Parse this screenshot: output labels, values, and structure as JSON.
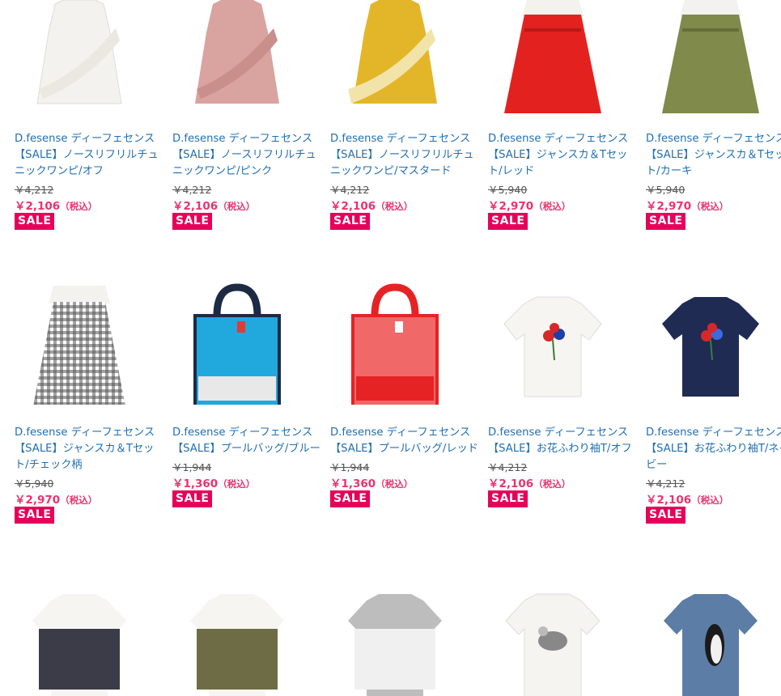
{
  "products_row1": [
    {
      "title": "D.fesense ディーフェセンス【SALE】ノースリフリルチュニックワンピ/オフ",
      "old_price": "￥4,212",
      "price": "￥2,106",
      "tax": "（税込）",
      "badge": "SALE",
      "image": "white-ruffle-tunic",
      "color": "#f4f2ee"
    },
    {
      "title": "D.fesense ディーフェセンス【SALE】ノースリフリルチュニックワンピ/ピンク",
      "old_price": "￥4,212",
      "price": "￥2,106",
      "tax": "（税込）",
      "badge": "SALE",
      "image": "pink-ruffle-tunic",
      "color": "#d9a3a0"
    },
    {
      "title": "D.fesense ディーフェセンス【SALE】ノースリフリルチュニックワンピ/マスタード",
      "old_price": "￥4,212",
      "price": "￥2,106",
      "tax": "（税込）",
      "badge": "SALE",
      "image": "mustard-ruffle-tunic",
      "color": "#e3b62a"
    },
    {
      "title": "D.fesense ディーフェセンス【SALE】ジャンスカ＆Tセット/レッド",
      "old_price": "￥5,940",
      "price": "￥2,970",
      "tax": "（税込）",
      "badge": "SALE",
      "image": "red-jumper-skirt",
      "color": "#e3221f"
    },
    {
      "title": "D.fesense ディーフェセンス【SALE】ジャンスカ＆Tセット/カーキ",
      "old_price": "￥5,940",
      "price": "￥2,970",
      "tax": "（税込）",
      "badge": "SALE",
      "image": "khaki-jumper-skirt",
      "color": "#7f8a4b"
    }
  ],
  "products_row2": [
    {
      "title": "D.fesense ディーフェセンス【SALE】ジャンスカ＆Tセット/チェック柄",
      "old_price": "￥5,940",
      "price": "￥2,970",
      "tax": "（税込）",
      "badge": "SALE",
      "image": "gingham-jumper-skirt",
      "color": "#4a4a4a"
    },
    {
      "title": "D.fesense ディーフェセンス【SALE】プールバッグ/ブルー",
      "old_price": "￥1,944",
      "price": "￥1,360",
      "tax": "（税込）",
      "badge": "SALE",
      "image": "blue-pool-bag",
      "color": "#21a8dd"
    },
    {
      "title": "D.fesense ディーフェセンス【SALE】プールバッグ/レッド",
      "old_price": "￥1,944",
      "price": "￥1,360",
      "tax": "（税込）",
      "badge": "SALE",
      "image": "red-pool-bag",
      "color": "#e62324"
    },
    {
      "title": "D.fesense ディーフェセンス【SALE】お花ふわり袖T/オフ",
      "old_price": "￥4,212",
      "price": "￥2,106",
      "tax": "（税込）",
      "badge": "SALE",
      "image": "white-flower-tee",
      "color": "#f6f5f2"
    },
    {
      "title": "D.fesense ディーフェセンス【SALE】お花ふわり袖T/ネイビー",
      "old_price": "￥4,212",
      "price": "￥2,106",
      "tax": "（税込）",
      "badge": "SALE",
      "image": "navy-flower-tee",
      "color": "#1f2b52"
    }
  ],
  "products_row3": [
    {
      "image": "gingham-bow-tee",
      "color": "#3c3c48"
    },
    {
      "image": "khaki-bow-tee",
      "color": "#6e6c44"
    },
    {
      "image": "dot-bow-tee",
      "color": "#bdbdbd"
    },
    {
      "image": "seagull-tee",
      "color": "#f5f4f0"
    },
    {
      "image": "penguin-tee",
      "color": "#5c7da6"
    }
  ]
}
